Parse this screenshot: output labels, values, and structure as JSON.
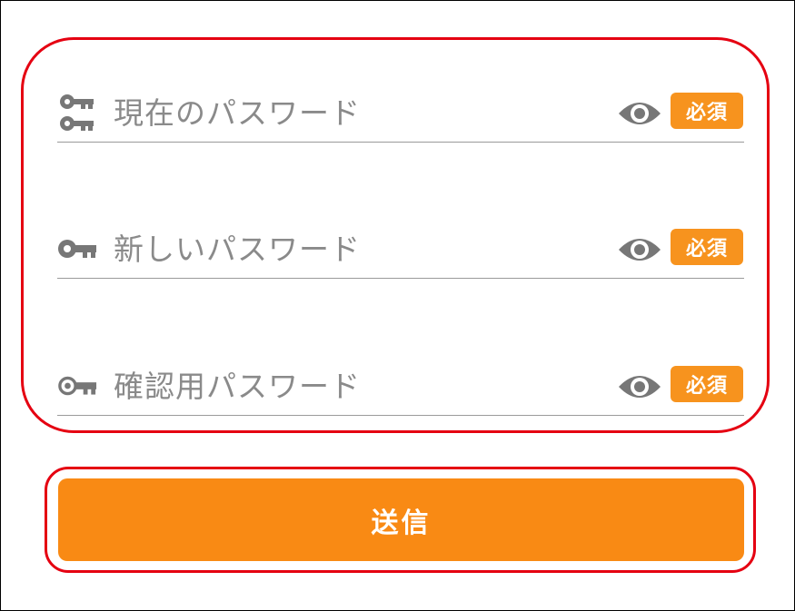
{
  "form": {
    "fields": [
      {
        "label": "現在のパスワード",
        "icon": "double-key-icon",
        "badge": "必須"
      },
      {
        "label": "新しいパスワード",
        "icon": "key-icon",
        "badge": "必須"
      },
      {
        "label": "確認用パスワード",
        "icon": "outline-key-icon",
        "badge": "必須"
      }
    ],
    "submit_label": "送信"
  },
  "colors": {
    "accent": "#f98a14",
    "badge": "#f7931e",
    "highlight": "#e50011",
    "label_text": "#8a8a8a",
    "icon": "#777777"
  }
}
